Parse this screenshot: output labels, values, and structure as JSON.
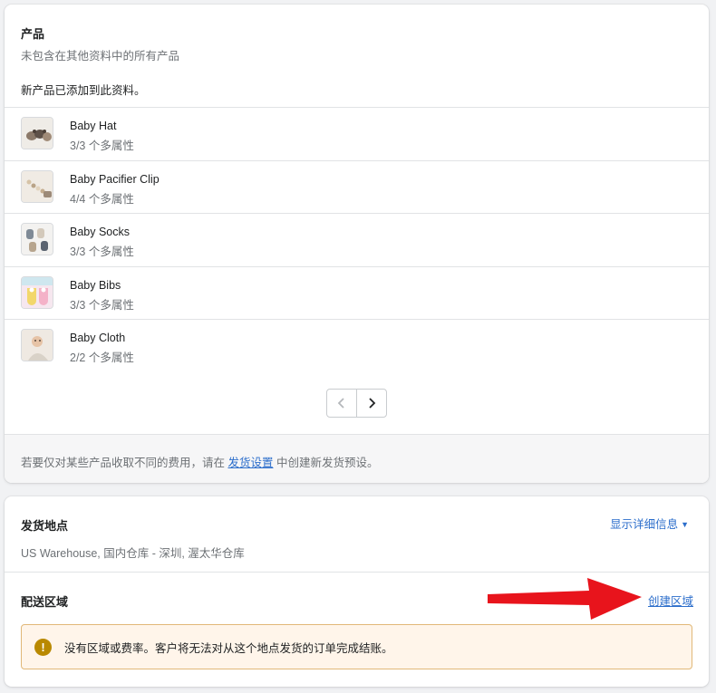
{
  "products_section": {
    "title": "产品",
    "subtitle": "未包含在其他资料中的所有产品",
    "note": "新产品已添加到此资料。",
    "items": [
      {
        "name": "Baby Hat",
        "variants": "3/3 个多属性",
        "thumb_icon": "baby-hat-thumbnail"
      },
      {
        "name": "Baby Pacifier Clip",
        "variants": "4/4 个多属性",
        "thumb_icon": "pacifier-clip-thumbnail"
      },
      {
        "name": "Baby Socks",
        "variants": "3/3 个多属性",
        "thumb_icon": "baby-socks-thumbnail"
      },
      {
        "name": "Baby Bibs",
        "variants": "3/3 个多属性",
        "thumb_icon": "baby-bibs-thumbnail"
      },
      {
        "name": "Baby Cloth",
        "variants": "2/2 个多属性",
        "thumb_icon": "baby-cloth-thumbnail"
      }
    ],
    "pagination": {
      "prev_icon": "chevron-left-icon",
      "next_icon": "chevron-right-icon"
    },
    "footer": {
      "text_before": "若要仅对某些产品收取不同的费用，请在 ",
      "link": "发货设置",
      "text_after": " 中创建新发货预设。"
    }
  },
  "shipping_section": {
    "origin_title": "发货地点",
    "origin_value": "US Warehouse, 国内仓库 - 深圳, 渥太华仓库",
    "show_details": "显示详细信息",
    "zones_title": "配送区域",
    "create_zone": "创建区域",
    "warning": "没有区域或费率。客户将无法对从这个地点发货的订单完成结账。"
  },
  "colors": {
    "link": "#2c6ecb",
    "warning_bg": "#fff5ea",
    "warning_border": "#e1b878",
    "warning_icon": "#b98900",
    "annotation_arrow": "#e8141c"
  }
}
